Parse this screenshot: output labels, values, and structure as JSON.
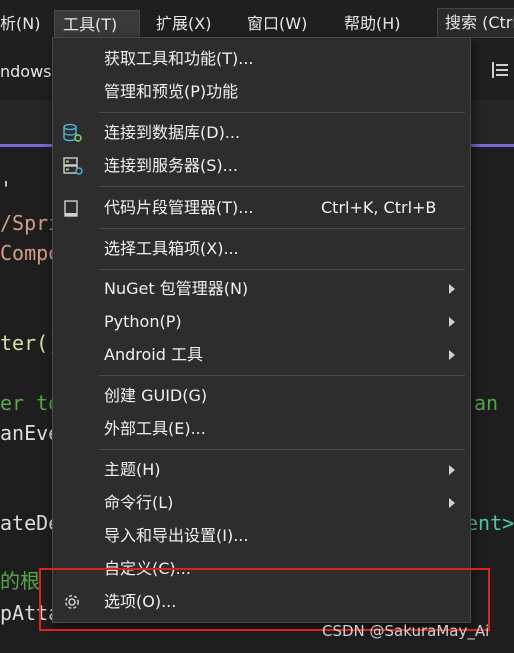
{
  "menubar": {
    "items": [
      "析(N)",
      "工具(T)",
      "扩展(X)",
      "窗口(W)",
      "帮助(H)"
    ],
    "search_label": "搜索 (Ctrl"
  },
  "toolbar": {
    "text": "ndows"
  },
  "code_lines": [
    {
      "text": "'",
      "color": "white"
    },
    {
      "text": "/Spri",
      "color": "orange"
    },
    {
      "text": "Compo",
      "color": "orange"
    },
    {
      "text": "ter()",
      "color": "yellow"
    },
    {
      "text": "er to",
      "color": "green"
    },
    {
      "text": "anEve",
      "color": "white"
    },
    {
      "text": "ateDe",
      "color": "white"
    },
    {
      "text": "的根",
      "color": "green"
    },
    {
      "text": "pAtta",
      "color": "white"
    },
    {
      "text": "an",
      "color": "green"
    },
    {
      "text": "ent>",
      "color": "teal"
    }
  ],
  "tools_menu": {
    "items": [
      {
        "label": "获取工具和功能(T)..."
      },
      {
        "label": "管理和预览(P)功能"
      },
      {
        "label": "连接到数据库(D)...",
        "icon": "database-connect-icon"
      },
      {
        "label": "连接到服务器(S)...",
        "icon": "server-connect-icon"
      },
      {
        "label": "代码片段管理器(T)...",
        "icon": "snippet-icon",
        "shortcut": "Ctrl+K, Ctrl+B"
      },
      {
        "label": "选择工具箱项(X)..."
      },
      {
        "label": "NuGet 包管理器(N)",
        "submenu": true
      },
      {
        "label": "Python(P)",
        "submenu": true
      },
      {
        "label": "Android 工具",
        "submenu": true
      },
      {
        "label": "创建 GUID(G)"
      },
      {
        "label": "外部工具(E)..."
      },
      {
        "label": "主题(H)",
        "submenu": true
      },
      {
        "label": "命令行(L)",
        "submenu": true
      },
      {
        "label": "导入和导出设置(I)..."
      },
      {
        "label": "自定义(C)..."
      },
      {
        "label": "选项(O)...",
        "icon": "gear-icon"
      }
    ]
  },
  "watermark": "CSDN @SakuraMay_Ai",
  "colors": {
    "accent": "#7b6ad6",
    "highlight": "#e02020",
    "menu_bg": "#2d2d2d"
  }
}
